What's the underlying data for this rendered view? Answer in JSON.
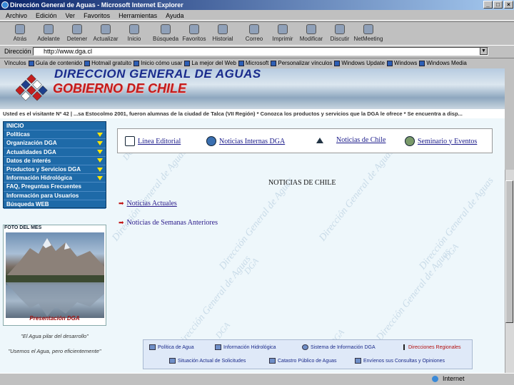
{
  "window": {
    "title": "Dirección General de Aguas - Microsoft Internet Explorer",
    "min": "_",
    "max": "□",
    "close": "×"
  },
  "menu": [
    "Archivo",
    "Edición",
    "Ver",
    "Favoritos",
    "Herramientas",
    "Ayuda"
  ],
  "toolbar": [
    {
      "label": "Atrás",
      "icon": "back-icon"
    },
    {
      "label": "Adelante",
      "icon": "forward-icon"
    },
    {
      "label": "Detener",
      "icon": "stop-icon"
    },
    {
      "label": "Actualizar",
      "icon": "refresh-icon"
    },
    {
      "label": "Inicio",
      "icon": "home-icon"
    },
    {
      "label": "Búsqueda",
      "icon": "search-icon"
    },
    {
      "label": "Favoritos",
      "icon": "favorites-icon"
    },
    {
      "label": "Historial",
      "icon": "history-icon"
    },
    {
      "label": "Correo",
      "icon": "mail-icon"
    },
    {
      "label": "Imprimir",
      "icon": "print-icon"
    },
    {
      "label": "Modificar",
      "icon": "edit-icon"
    },
    {
      "label": "Discutir",
      "icon": "discuss-icon"
    },
    {
      "label": "NetMeeting",
      "icon": "netmeeting-icon"
    }
  ],
  "address": {
    "label": "Dirección",
    "value": "http://www.dga.cl"
  },
  "links": {
    "label": "Vínculos",
    "items": [
      "Guía de contenido",
      "Hotmail gratuito",
      "Inicio cómo usar",
      "La mejor del Web",
      "Microsoft",
      "Personalizar vínculos",
      "Windows Update",
      "Windows",
      "Windows Media"
    ]
  },
  "page": {
    "title1": "DIRECCIÓN GENERAL DE AGUAS",
    "title2": "GOBIERNO DE CHILE",
    "ticker": "Usted es el visitante Nº 42 | ...sa Estocolmo 2001, fueron alumnas de la ciudad de Talca (VII Región) * Conozca los productos y servicios que la DGA le ofrece * Se encuentra a disp...",
    "nav": [
      "INICIO",
      "Políticas",
      "Organización DGA",
      "Actualidades DGA",
      "Datos de interés",
      "Productos y Servicios DGA",
      "Información Hidrológica",
      "FAQ, Preguntas Frecuentes",
      "Información para Usuarios",
      "Búsqueda WEB"
    ],
    "nav_arrows": [
      false,
      true,
      true,
      true,
      true,
      true,
      true,
      false,
      false,
      false
    ],
    "photo_label": "FOTO DEL MES",
    "presentation": "Presentación DGA",
    "quote1": "\"El Agua pilar del desarrollo\"",
    "quote2": "\"Usemos el Agua, pero eficientemente\"",
    "tabs": [
      "Línea Editorial",
      "Noticias Internas DGA",
      "Noticias de Chile",
      "Seminario y Eventos"
    ],
    "heading": "NOTICIAS DE CHILE",
    "news": [
      "Noticias Actuales",
      "Noticias de Semanas Anteriores"
    ],
    "watermark": "Dirección General de Aguas",
    "watermark_short": "DGA",
    "bottom_links": [
      "Política de Agua",
      "Información Hidrológica",
      "Sistema de Información DGA",
      "Direcciones Regionales",
      "Situación Actual de Solicitudes",
      "Catastro Público de Aguas",
      "Envíenos sus Consultas y Opiniones"
    ]
  },
  "status": {
    "left": "",
    "zone": "Internet"
  }
}
